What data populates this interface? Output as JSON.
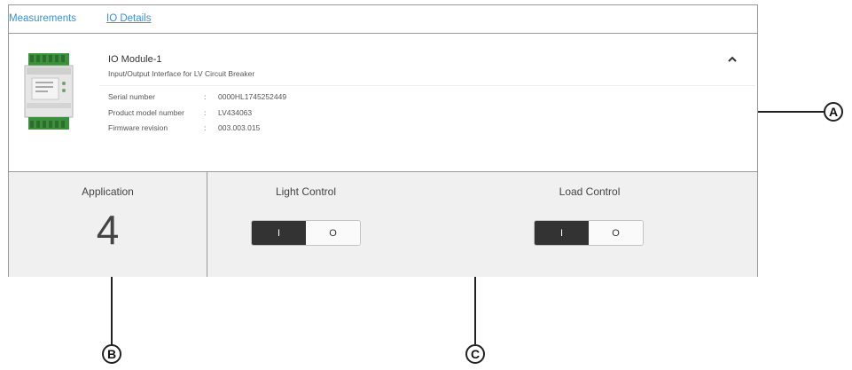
{
  "tabs": [
    {
      "label": "Measurements",
      "active": false
    },
    {
      "label": "IO Details",
      "active": true
    }
  ],
  "device": {
    "title": "IO Module-1",
    "subtitle": "Input/Output Interface for LV Circuit Breaker",
    "chevron_icon": "chevron-up-icon",
    "info": [
      {
        "key": "Serial number",
        "sep": ":",
        "value": "0000HL1745252449"
      },
      {
        "key": "Product model number",
        "sep": ":",
        "value": "LV434063"
      },
      {
        "key": "Firmware revision",
        "sep": ":",
        "value": "003.003.015"
      }
    ]
  },
  "application": {
    "label": "Application",
    "value": "4"
  },
  "controls": [
    {
      "label": "Light Control",
      "on_label": "I",
      "off_label": "O",
      "state": "on"
    },
    {
      "label": "Load Control",
      "on_label": "I",
      "off_label": "O",
      "state": "on"
    }
  ],
  "callouts": {
    "a": "A",
    "b": "B",
    "c": "C"
  },
  "colors": {
    "link": "#3d8fd6",
    "toggle_on": "#333333",
    "card_bg": "#f0f0f0",
    "border": "#9a9a9a"
  }
}
